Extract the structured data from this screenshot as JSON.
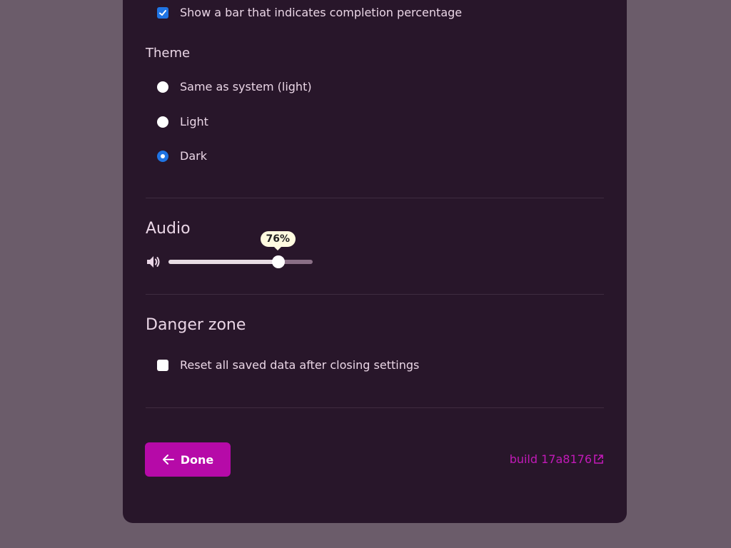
{
  "display": {
    "completion_bar_label": "Show a bar that indicates completion percentage",
    "completion_bar_checked": true
  },
  "theme": {
    "heading": "Theme",
    "options": [
      {
        "label": "Same as system (light)",
        "selected": false
      },
      {
        "label": "Light",
        "selected": false
      },
      {
        "label": "Dark",
        "selected": true
      }
    ]
  },
  "audio": {
    "heading": "Audio",
    "volume_percent": 76,
    "volume_label": "76%",
    "icon": "speaker-icon"
  },
  "danger": {
    "heading": "Danger zone",
    "reset_label": "Reset all saved data after closing settings",
    "reset_checked": false
  },
  "footer": {
    "done_label": "Done",
    "build_label": "build 17a8176"
  },
  "colors": {
    "accent": "#b60aa8",
    "checkbox_blue": "#1f74e3",
    "panel_bg": "#28162a",
    "backdrop": "#6b5c6a"
  }
}
